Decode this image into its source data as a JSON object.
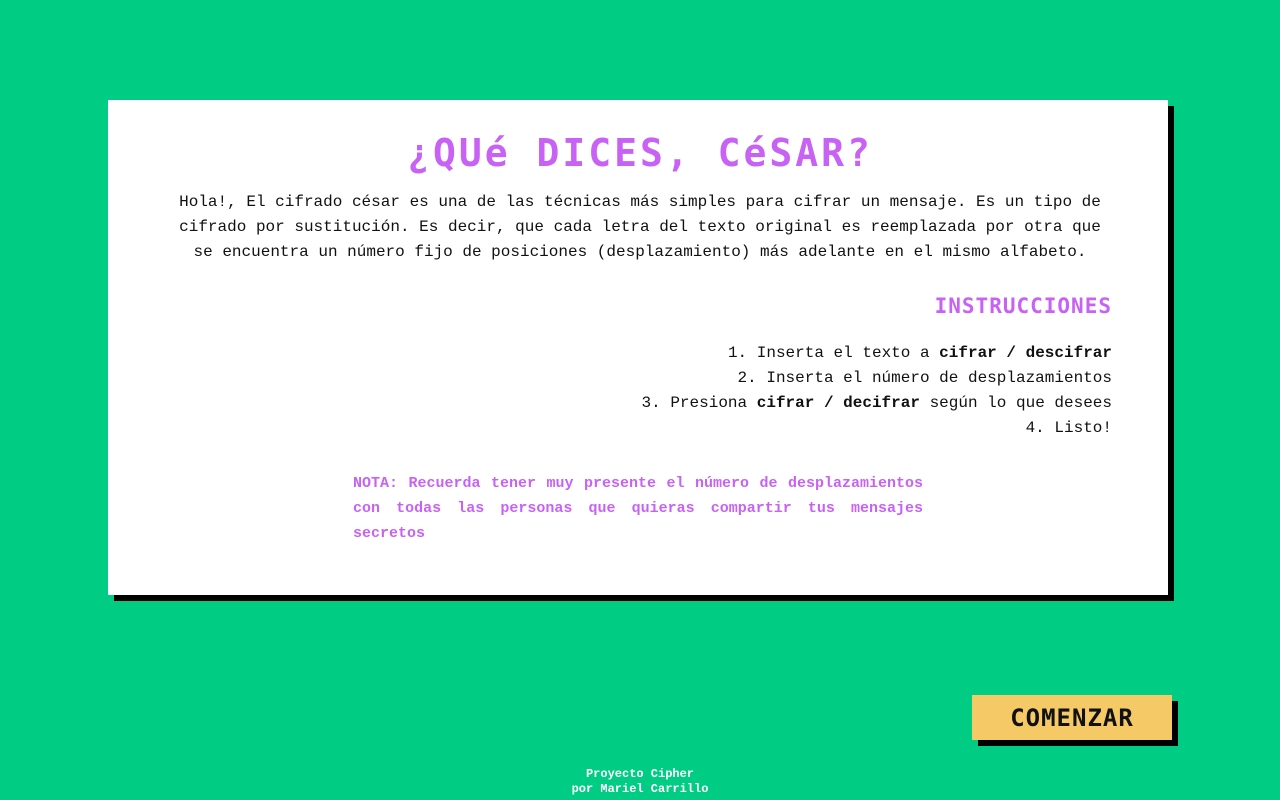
{
  "colors": {
    "background": "#00cc83",
    "card": "#ffffff",
    "accent": "#c862f5",
    "button": "#f4c966",
    "shadow": "#000000"
  },
  "header": {
    "title": "¿QUé DICES, CéSAR?"
  },
  "intro": {
    "text": "Hola!, El cifrado césar es una de las técnicas más simples para cifrar un mensaje. Es un tipo de cifrado por sustitución. Es decir, que cada letra del texto original es reemplazada por otra que se encuentra un número fijo de posiciones (desplazamiento) más adelante en el mismo alfabeto."
  },
  "instructions": {
    "title": "INSTRUCCIONES",
    "steps": [
      {
        "prefix": "1. Inserta el texto a ",
        "bold": "cifrar / descifrar",
        "suffix": ""
      },
      {
        "prefix": "2. Inserta el número de desplazamientos",
        "bold": "",
        "suffix": ""
      },
      {
        "prefix": "3. Presiona ",
        "bold": "cifrar / decifrar",
        "suffix": " según lo que desees"
      },
      {
        "prefix": "4. Listo!",
        "bold": "",
        "suffix": ""
      }
    ]
  },
  "note": {
    "text": "NOTA: Recuerda tener muy presente el número de desplazamientos con todas las personas que quieras compartir tus mensajes secretos"
  },
  "actions": {
    "start_label": "COMENZAR"
  },
  "footer": {
    "line1": "Proyecto Cipher",
    "line2": "por Mariel Carrillo"
  }
}
